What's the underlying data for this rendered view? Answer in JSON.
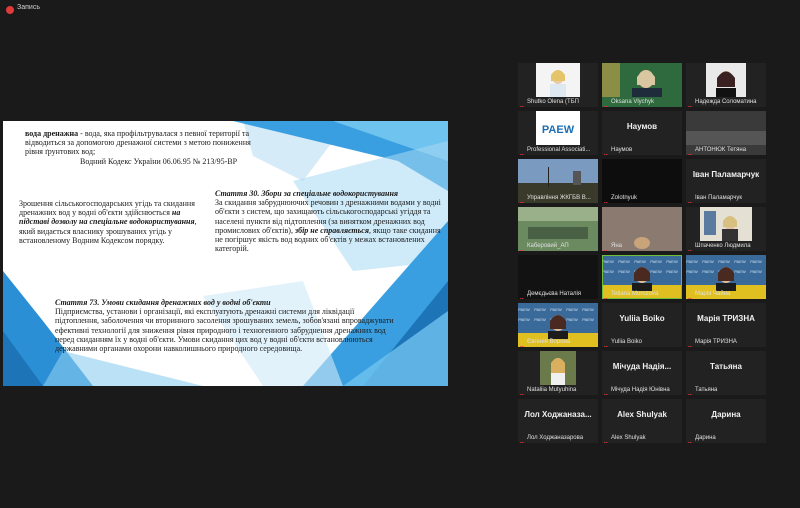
{
  "recording": {
    "label": "Запись"
  },
  "slide": {
    "para1_bold": "вода дренажна",
    "para1_text": " - вода, яка профільтрувалася з певної території та відводиться за допомогою дренажної системи з метою пониження рівня ґрунтових вод;",
    "para1_source": "Водний Кодекс України 06.06.95 № 213/95-ВР",
    "para2_text_a": "Зрошення сільськогосподарських угідь та скидання дренажних вод у водні об'єкти здійснюється ",
    "para2_bold": "на підставі дозволу на спеціальне водокористування",
    "para2_text_b": ", який видається власнику зрошуваних угідь у встановленому Водним Кодексом порядку.",
    "art30_title": "Стаття 30. Збори за спеціальне водокористування",
    "art30_text_a": "За скидання забруднюючих речовин з дренажними водами у водні об'єкти з систем, що захищають сільськогосподарські угіддя та населені пункти від підтоплення (за винятком дренажних вод промислових об'єктів), ",
    "art30_bold": "збір не справляється",
    "art30_text_b": ", якщо таке скидання не погіршує якість вод водних об'єктів у межах встановлених категорій.",
    "art73_title": "Стаття 73. Умови скидання дренажних вод у водні об'єкти",
    "art73_text": "Підприємства, установи і організації, які експлуатують дренажні системи для ліквідації підтоплення, заболочення чи вторинного засолення зрошуваних земель, зобов'язані впроваджувати ефективні технології для зниження рівня природного і техногенного забруднення дренажних вод перед скиданням їх у водні об'єкти. Умови скидання цих вод у водні об'єкти встановлюються державними органами охорони навколишнього природного середовища."
  },
  "participants": [
    {
      "name": "Shutko Olena (ТБП",
      "big": "",
      "bg": "#f4f4f4",
      "kind": "person-light"
    },
    {
      "name": "Oksana Vlychyk",
      "big": "",
      "bg": "#2f6a3e",
      "kind": "person-green"
    },
    {
      "name": "Надежда Соломатина",
      "big": "",
      "bg": "#2a2a2a",
      "kind": "person-dark"
    },
    {
      "name": "Professional Associati...",
      "big": "",
      "bg": "#ffffff",
      "kind": "paew",
      "logo": "PAEW"
    },
    {
      "name": "Наумов",
      "big": "Наумов",
      "bg": "#222",
      "kind": "text"
    },
    {
      "name": "АНТОНЮК Тетяна",
      "big": "",
      "bg": "#3a3a3a",
      "kind": "photo-grey"
    },
    {
      "name": "Управління ЖКГБВ В...",
      "big": "",
      "bg": "#506a8a",
      "kind": "photo-sky"
    },
    {
      "name": "Zolotnyuk",
      "big": "",
      "bg": "#0d0d0d",
      "kind": "dark"
    },
    {
      "name": "Іван Паламарчук",
      "big": "Іван Паламарчук",
      "bg": "#222",
      "kind": "text"
    },
    {
      "name": "Каберовий_АП",
      "big": "",
      "bg": "#5c7a56",
      "kind": "photo-green"
    },
    {
      "name": "Яна",
      "big": "",
      "bg": "#7a6a60",
      "kind": "photo-warm"
    },
    {
      "name": "Шпаченко Людмила",
      "big": "",
      "bg": "#4a4a3a",
      "kind": "person-room"
    },
    {
      "name": "Демєдьєва Наталія",
      "big": "",
      "bg": "#121212",
      "kind": "dark"
    },
    {
      "name": "Tetiana Morozova",
      "big": "",
      "bg": "#3a6a9a",
      "kind": "paew-wall",
      "logo": "PAEW",
      "highlight": true
    },
    {
      "name": "Марія Чайна",
      "big": "",
      "bg": "#3a6a9a",
      "kind": "paew-wall",
      "logo": "PAEW"
    },
    {
      "name": "Євгенія Ворона",
      "big": "",
      "bg": "#3a6a9a",
      "kind": "paew-wall",
      "logo": "PAEW"
    },
    {
      "name": "Yuliia Boiko",
      "big": "Yuliia Boiko",
      "bg": "#222",
      "kind": "text"
    },
    {
      "name": "Марія ТРИЗНА",
      "big": "Марія ТРИЗНА",
      "bg": "#222",
      "kind": "text"
    },
    {
      "name": "Nataliia Mutyuhina",
      "big": "",
      "bg": "#2a2a2a",
      "kind": "person-outdoor"
    },
    {
      "name": "Мічуда Надія Юнівна",
      "big": "Мічуда Надія...",
      "bg": "#222",
      "kind": "text"
    },
    {
      "name": "Татьяна",
      "big": "Татьяна",
      "bg": "#222",
      "kind": "text"
    },
    {
      "name": "Лол Ходжаназарова",
      "big": "Лол Ходжаназа...",
      "bg": "#222",
      "kind": "text"
    },
    {
      "name": "Alex Shulyak",
      "big": "Alex Shulyak",
      "bg": "#222",
      "kind": "text"
    },
    {
      "name": "Дарина",
      "big": "Дарина",
      "bg": "#222",
      "kind": "text"
    }
  ],
  "colors": {
    "slide_accent": "#2a8fd4",
    "slide_light": "#6fc3ef",
    "mute_red": "#e03a3a",
    "active_speaker": "#6fbf3a"
  }
}
